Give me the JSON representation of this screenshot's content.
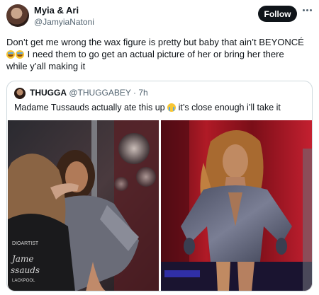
{
  "author": {
    "name": "Myia & Ari",
    "handle": "@JamyiaNatoni"
  },
  "follow_label": "Follow",
  "tweet": {
    "line1": "Don’t get me wrong the wax figure is pretty but baby that ain’t BEYONCÉ",
    "line2": "I need them to go get an actual picture of her or bring her there",
    "line3": "while y’all making it"
  },
  "quote": {
    "name": "THUGGA",
    "handle": "@THUGGABEY",
    "time": "· 7h",
    "text_before": "Madame Tussauds actually ate this up",
    "text_after": "it’s close enough i’ll take it"
  },
  "photo_left": {
    "shirt_line1": "DIOARTIST",
    "shirt_line2": "Jame",
    "shirt_line3": "ssauds",
    "shirt_line4": "LACKPOOL"
  },
  "icons": [
    "more-icon",
    "laughing-emoji",
    "crying-emoji"
  ]
}
